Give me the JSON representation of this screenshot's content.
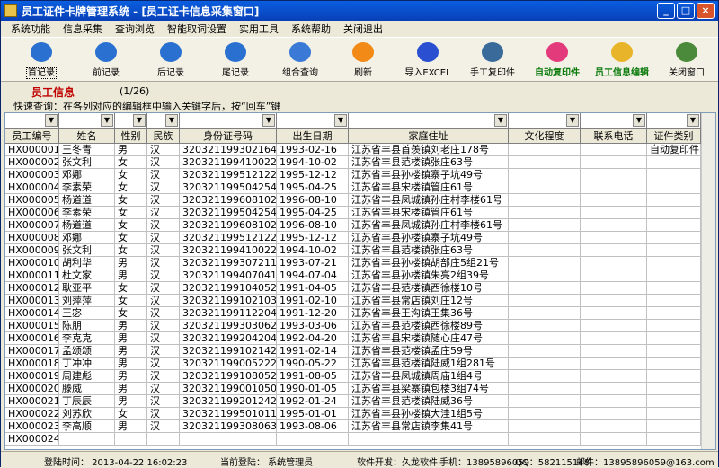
{
  "window": {
    "title": "员工证件卡牌管理系统 - [员工证卡信息采集窗口]"
  },
  "menu": [
    "系统功能",
    "信息采集",
    "查询浏览",
    "智能取词设置",
    "实用工具",
    "系统帮助",
    "关闭退出"
  ],
  "toolbar": [
    {
      "label": "首记录",
      "icon": "first-record-icon",
      "color": "#2a70d0"
    },
    {
      "label": "前记录",
      "icon": "prev-record-icon",
      "color": "#2a70d0"
    },
    {
      "label": "后记录",
      "icon": "next-record-icon",
      "color": "#2a70d0"
    },
    {
      "label": "尾记录",
      "icon": "last-record-icon",
      "color": "#2a70d0"
    },
    {
      "label": "组合查询",
      "icon": "query-icon",
      "color": "#3a7ad6"
    },
    {
      "label": "刷新",
      "icon": "refresh-icon",
      "color": "#f28a18"
    },
    {
      "label": "导入EXCEL",
      "icon": "excel-import-icon",
      "color": "#2a4fd0"
    },
    {
      "label": "手工复印件",
      "icon": "copy-icon",
      "color": "#3a6a9a"
    },
    {
      "label": "自动复印件",
      "icon": "auto-copy-icon",
      "color": "#e23a7a"
    },
    {
      "label": "员工信息编辑",
      "icon": "edit-icon",
      "color": "#e8b42a"
    },
    {
      "label": "关闭窗口",
      "icon": "close-window-icon",
      "color": "#4a8a3a"
    }
  ],
  "info": {
    "title": "员工信息",
    "pager": "(1/26)"
  },
  "hint": "快速查询：在各列对应的编辑框中输入关键字后，按“回车”键",
  "columns": [
    "员工编号",
    "姓名",
    "性别",
    "民族",
    "身份证号码",
    "出生日期",
    "家庭住址",
    "文化程度",
    "联系电话",
    "证件类别"
  ],
  "rows": [
    [
      "HX000001",
      "王冬青",
      "男",
      "汉",
      "320321199302164013",
      "1993-02-16",
      "江苏省丰县首羡镇刘老庄178号",
      "",
      "",
      "自动复印件"
    ],
    [
      "HX000002",
      "张文利",
      "女",
      "汉",
      "320321199410022020",
      "1994-10-02",
      "江苏省丰县范楼镇张庄63号",
      "",
      "",
      ""
    ],
    [
      "HX000003",
      "邓娜",
      "女",
      "汉",
      "320321199512122022",
      "1995-12-12",
      "江苏省丰县孙楼镇寨子坑49号",
      "",
      "",
      ""
    ],
    [
      "HX000004",
      "李素荣",
      "女",
      "汉",
      "320321199504254826",
      "1995-04-25",
      "江苏省丰县宋楼镇管庄61号",
      "",
      "",
      ""
    ],
    [
      "HX000005",
      "杨道道",
      "女",
      "汉",
      "320321199608102640",
      "1996-08-10",
      "江苏省丰县凤城镇孙庄村李楼61号",
      "",
      "",
      ""
    ],
    [
      "HX000006",
      "李素荣",
      "女",
      "汉",
      "320321199504254826",
      "1995-04-25",
      "江苏省丰县宋楼镇管庄61号",
      "",
      "",
      ""
    ],
    [
      "HX000007",
      "杨道道",
      "女",
      "汉",
      "320321199608102640",
      "1996-08-10",
      "江苏省丰县凤城镇孙庄村李楼61号",
      "",
      "",
      ""
    ],
    [
      "HX000008",
      "邓娜",
      "女",
      "汉",
      "320321199512122022",
      "1995-12-12",
      "江苏省丰县孙楼镇寨子坑49号",
      "",
      "",
      ""
    ],
    [
      "HX000009",
      "张文利",
      "女",
      "汉",
      "320321199410022020",
      "1994-10-02",
      "江苏省丰县范楼镇张庄63号",
      "",
      "",
      ""
    ],
    [
      "HX000010",
      "胡利华",
      "男",
      "汉",
      "320321199307211413",
      "1993-07-21",
      "江苏省丰县孙楼镇胡部庄5组21号",
      "",
      "",
      ""
    ],
    [
      "HX000011",
      "杜文家",
      "男",
      "汉",
      "320321199407041431",
      "1994-07-04",
      "江苏省丰县孙楼镇朱亮2组39号",
      "",
      "",
      ""
    ],
    [
      "HX000012",
      "耿亚平",
      "女",
      "汉",
      "320321199104052029",
      "1991-04-05",
      "江苏省丰县范楼镇西徐楼10号",
      "",
      "",
      ""
    ],
    [
      "HX000013",
      "刘萍萍",
      "女",
      "汉",
      "320321199102103929",
      "1991-02-10",
      "江苏省丰县常店镇刘庄12号",
      "",
      "",
      ""
    ],
    [
      "HX000014",
      "王宓",
      "女",
      "汉",
      "320321199112204424",
      "1991-12-20",
      "江苏省丰县王沟镇王集36号",
      "",
      "",
      ""
    ],
    [
      "HX000015",
      "陈朋",
      "男",
      "汉",
      "320321199303062035",
      "1993-03-06",
      "江苏省丰县范楼镇西徐楼89号",
      "",
      "",
      ""
    ],
    [
      "HX000016",
      "李克克",
      "男",
      "汉",
      "320321199204204851",
      "1992-04-20",
      "江苏省丰县宋楼镇随心庄47号",
      "",
      "",
      ""
    ],
    [
      "HX000017",
      "孟颂颂",
      "男",
      "汉",
      "320321199102142012",
      "1991-02-14",
      "江苏省丰县范楼镇孟庄59号",
      "",
      "",
      ""
    ],
    [
      "HX000018",
      "丁冲冲",
      "男",
      "汉",
      "320321199005222010",
      "1990-05-22",
      "江苏省丰县范楼镇陆威1组281号",
      "",
      "",
      ""
    ],
    [
      "HX000019",
      "周建彪",
      "男",
      "汉",
      "320321199108052616",
      "1991-08-05",
      "江苏省丰县凤城镇周庙1组4号",
      "",
      "",
      ""
    ],
    [
      "HX000020",
      "滕威",
      "男",
      "汉",
      "320321199001050856",
      "1990-01-05",
      "江苏省丰县梁寨镇包楼3组74号",
      "",
      "",
      ""
    ],
    [
      "HX000021",
      "丁辰辰",
      "男",
      "汉",
      "320321199201242019",
      "1992-01-24",
      "江苏省丰县范楼镇陆威36号",
      "",
      "",
      ""
    ],
    [
      "HX000022",
      "刘苏欣",
      "女",
      "汉",
      "320321199501011423",
      "1995-01-01",
      "江苏省丰县孙楼镇大洼1组5号",
      "",
      "",
      ""
    ],
    [
      "HX000023",
      "李高顺",
      "男",
      "汉",
      "320321199308063854",
      "1993-08-06",
      "江苏省丰县常店镇李集41号",
      "",
      "",
      ""
    ],
    [
      "HX000024",
      "",
      "",
      "",
      "",
      "",
      "",
      "",
      "",
      ""
    ]
  ],
  "status": {
    "login_time": "登陆时间： 2013-04-22 16:02:23",
    "current_user": "当前登陆： 系统管理员",
    "developer": "软件开发：久龙软件",
    "phone": "手机：13895896059",
    "qq": "QQ：582115148",
    "email": "邮件：13895896059@163.com"
  }
}
